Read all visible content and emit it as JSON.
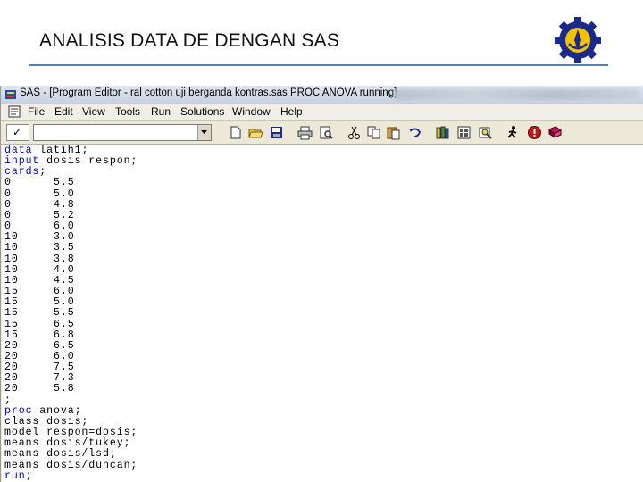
{
  "slide": {
    "title": "ANALISIS DATA DE DENGAN SAS"
  },
  "window": {
    "title": "SAS - [Program Editor - ral cotton uji berganda kontras.sas PROC ANOVA running]"
  },
  "menu": {
    "items": [
      "File",
      "Edit",
      "View",
      "Tools",
      "Run",
      "Solutions",
      "Window",
      "Help"
    ]
  },
  "toolbar": {
    "check_label": "✓",
    "command_value": "",
    "icons": [
      "new-icon",
      "open-icon",
      "save-icon",
      "print-icon",
      "print-preview-icon",
      "cut-icon",
      "copy-icon",
      "paste-icon",
      "undo-icon",
      "libraries-icon",
      "explorer-icon",
      "find-icon",
      "submit-run-icon",
      "help-icon",
      "book-icon"
    ]
  },
  "editor": {
    "lines": [
      [
        {
          "t": "data",
          "k": 1
        },
        {
          "t": " latih1;"
        }
      ],
      [
        {
          "t": "input",
          "k": 1
        },
        {
          "t": " dosis respon;"
        }
      ],
      [
        {
          "t": "cards",
          "k": 1
        },
        {
          "t": ";"
        }
      ],
      [
        {
          "t": "0      5.5"
        }
      ],
      [
        {
          "t": "0      5.0"
        }
      ],
      [
        {
          "t": "0      4.8"
        }
      ],
      [
        {
          "t": "0      5.2"
        }
      ],
      [
        {
          "t": "0      6.0"
        }
      ],
      [
        {
          "t": "10     3.0"
        }
      ],
      [
        {
          "t": "10     3.5"
        }
      ],
      [
        {
          "t": "10     3.8"
        }
      ],
      [
        {
          "t": "10     4.0"
        }
      ],
      [
        {
          "t": "10     4.5"
        }
      ],
      [
        {
          "t": "15     6.0"
        }
      ],
      [
        {
          "t": "15     5.0"
        }
      ],
      [
        {
          "t": "15     5.5"
        }
      ],
      [
        {
          "t": "15     6.5"
        }
      ],
      [
        {
          "t": "15     6.8"
        }
      ],
      [
        {
          "t": "20     6.5"
        }
      ],
      [
        {
          "t": "20     6.0"
        }
      ],
      [
        {
          "t": "20     7.5"
        }
      ],
      [
        {
          "t": "20     7.3"
        }
      ],
      [
        {
          "t": "20     5.8"
        }
      ],
      [
        {
          "t": ";"
        }
      ],
      [
        {
          "t": "proc",
          "k": 1
        },
        {
          "t": " anova;"
        }
      ],
      [
        {
          "t": "class dosis;"
        }
      ],
      [
        {
          "t": "model respon=dosis;"
        }
      ],
      [
        {
          "t": "means dosis/tukey;"
        }
      ],
      [
        {
          "t": "means dosis/lsd;"
        }
      ],
      [
        {
          "t": "means dosis/duncan;"
        }
      ],
      [
        {
          "t": "run",
          "k": 1
        },
        {
          "t": ";"
        }
      ]
    ]
  },
  "colors": {
    "keyword": "#0000cc",
    "title_rule": "#5b7fa6"
  }
}
